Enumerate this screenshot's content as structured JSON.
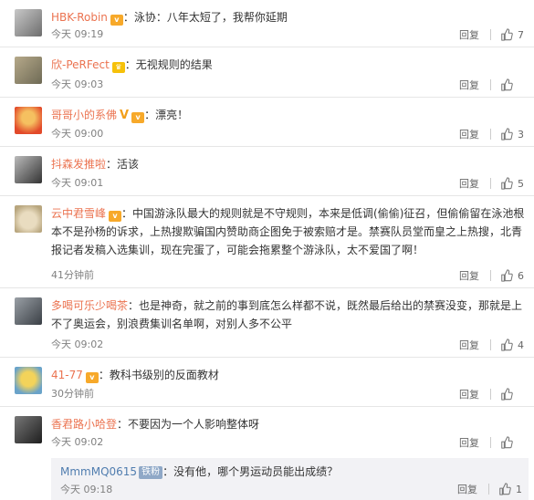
{
  "comments": [
    {
      "user": "HBK-Robin",
      "badges": [
        "vip"
      ],
      "text": "：泳协：八年太短了，我帮你延期",
      "time": "今天 09:19",
      "reply": "回复",
      "likes": "7"
    },
    {
      "user": "欣-PeRFect",
      "badges": [
        "crown"
      ],
      "text": "：无视规则的结果",
      "time": "今天 09:03",
      "reply": "回复",
      "likes": ""
    },
    {
      "user": "哥哥小的系佛",
      "badges": [
        "v",
        "vip"
      ],
      "text": "：漂亮！",
      "time": "今天 09:00",
      "reply": "回复",
      "likes": "3"
    },
    {
      "user": "抖森发推啦",
      "badges": [],
      "text": "：活该",
      "time": "今天 09:01",
      "reply": "回复",
      "likes": "5"
    },
    {
      "user": "云中君雪峰",
      "badges": [
        "vip"
      ],
      "text": "：中国游泳队最大的规则就是不守规则，本来是低调(偷偷)征召，但偷偷留在泳池根本不是孙杨的诉求，上热搜欺骗国内赞助商企图免于被索赔才是。禁赛队员堂而皇之上热搜，北青报记者发稿入选集训，现在完蛋了，可能会拖累整个游泳队，太不爱国了啊！",
      "time": "41分钟前",
      "reply": "回复",
      "likes": "6"
    },
    {
      "user": "多喝可乐少喝茶",
      "badges": [],
      "text": "：也是神奇，就之前的事到底怎么样都不说，既然最后给出的禁赛没变，那就是上不了奥运会，别浪费集训名单啊，对别人多不公平",
      "time": "今天 09:02",
      "reply": "回复",
      "likes": "4"
    },
    {
      "user": "41-77",
      "badges": [
        "vip"
      ],
      "text": "：教科书级别的反面教材",
      "time": "30分钟前",
      "reply": "回复",
      "likes": ""
    },
    {
      "user": "香君路小哈登",
      "badges": [],
      "text": "：不要因为一个人影响整体呀",
      "time": "今天 09:02",
      "reply": "回复",
      "likes": "",
      "sub": {
        "user": "MmmMQ0615",
        "badge": "铁粉",
        "text": "：没有他，哪个男运动员能出成绩？",
        "time": "今天 09:18",
        "reply": "回复",
        "likes": "1"
      }
    }
  ],
  "colors": {
    "username": "#eb7350",
    "subuser": "#507daf",
    "text": "#333333",
    "meta": "#808080"
  },
  "icons": {
    "like": "thumbs-up-icon"
  }
}
